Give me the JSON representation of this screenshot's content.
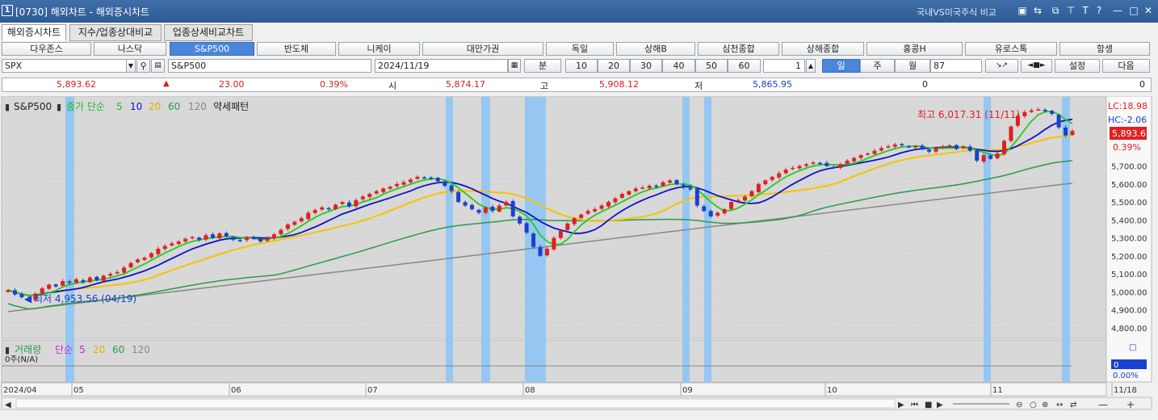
{
  "window": {
    "number": "1",
    "title": "[0730] 해외차트 - 해외증시차트",
    "right_link": "국내VS미국주식 비교",
    "icons": [
      "window-icon",
      "link-icon",
      "popup-icon",
      "pin-icon",
      "font-icon",
      "help-icon",
      "minimize-icon",
      "maximize-icon",
      "close-icon"
    ]
  },
  "tabs": [
    "해외증시차트",
    "지수/업종상대비교",
    "업종상세비교차트"
  ],
  "index_buttons": [
    "다우존스",
    "나스닥",
    "S&P500",
    "반도체",
    "니케이",
    "대만가권",
    "독일",
    "상해B",
    "심천종합",
    "상해종합",
    "홍콩H",
    "유로스톡",
    "항셍"
  ],
  "selected_index": "S&P500",
  "controls": {
    "symbol": "SPX",
    "name": "S&P500",
    "date": "2024/11/19",
    "minute_label": "분",
    "intervals": [
      "10",
      "20",
      "30",
      "40",
      "50",
      "60"
    ],
    "period_num": "1",
    "periods": [
      "일",
      "주",
      "월"
    ],
    "count": "87",
    "settings": "설정",
    "next": "다음"
  },
  "quote": {
    "price": "5,893.62",
    "change": "23.00",
    "pct": "0.39%",
    "open_label": "시",
    "open": "5,874.17",
    "high_label": "고",
    "high": "5,908.12",
    "low_label": "저",
    "low": "5,865.95",
    "vol1": "0",
    "vol2": "0"
  },
  "chart_data": {
    "type": "candlestick",
    "title": "S&P500",
    "legend": {
      "price_label": "종가 단순",
      "ma": [
        "5",
        "10",
        "20",
        "60",
        "120"
      ],
      "pattern": "약세패턴"
    },
    "volume_legend": {
      "label": "거래량",
      "simple": "단순",
      "ma": [
        "5",
        "20",
        "60",
        "120"
      ],
      "note": "0주(N/A)"
    },
    "x_labels": [
      "2024/04",
      "05",
      "06",
      "07",
      "08",
      "09",
      "10",
      "11",
      "11/18"
    ],
    "y_ticks": [
      "5,700.00",
      "5,600.00",
      "5,500.00",
      "5,400.00",
      "5,300.00",
      "5,200.00",
      "5,100.00",
      "5,000.00",
      "4,900.00",
      "4,800.00"
    ],
    "ylim": [
      4750,
      6080
    ],
    "max_label": "최고 6,017.31 (11/11)",
    "min_label": "최저 4,953.56 (04/19)",
    "lc": "LC:18.98",
    "hc": "HC:-2.06",
    "last_price": "5,893.6",
    "last_pct": "0.39%",
    "vol_value": "0",
    "vol_pct": "0.00%",
    "closes": [
      5010,
      4985,
      4970,
      4955,
      4990,
      5020,
      5040,
      5030,
      5060,
      5050,
      5070,
      5055,
      5080,
      5065,
      5090,
      5100,
      5110,
      5135,
      5160,
      5180,
      5190,
      5215,
      5240,
      5255,
      5270,
      5280,
      5295,
      5305,
      5290,
      5315,
      5300,
      5325,
      5310,
      5290,
      5285,
      5305,
      5295,
      5280,
      5300,
      5320,
      5345,
      5375,
      5390,
      5410,
      5440,
      5455,
      5470,
      5460,
      5485,
      5500,
      5475,
      5510,
      5530,
      5545,
      5560,
      5575,
      5585,
      5600,
      5610,
      5625,
      5640,
      5635,
      5630,
      5615,
      5590,
      5560,
      5500,
      5480,
      5460,
      5440,
      5470,
      5450,
      5480,
      5500,
      5420,
      5380,
      5330,
      5250,
      5200,
      5240,
      5300,
      5340,
      5380,
      5410,
      5430,
      5450,
      5460,
      5480,
      5500,
      5520,
      5545,
      5560,
      5575,
      5580,
      5590,
      5585,
      5610,
      5620,
      5600,
      5580,
      5570,
      5480,
      5450,
      5420,
      5440,
      5460,
      5500,
      5510,
      5530,
      5560,
      5600,
      5620,
      5640,
      5660,
      5680,
      5690,
      5700,
      5710,
      5720,
      5715,
      5700,
      5690,
      5710,
      5730,
      5745,
      5760,
      5770,
      5785,
      5800,
      5810,
      5820,
      5815,
      5805,
      5810,
      5795,
      5780,
      5800,
      5810,
      5815,
      5795,
      5810,
      5785,
      5730,
      5760,
      5740,
      5770,
      5840,
      5920,
      5980,
      6000,
      6010,
      6015,
      6005,
      5990,
      5915,
      5870,
      5895
    ],
    "highlight_bands": [
      [
        81,
        92
      ],
      [
        552,
        561
      ],
      [
        596,
        607
      ],
      [
        650,
        676
      ],
      [
        845,
        854
      ],
      [
        872,
        881
      ],
      [
        1218,
        1227
      ],
      [
        1315,
        1325
      ]
    ],
    "colors": {
      "up": "#e02020",
      "down": "#1a40d0",
      "ma5": "#22cc22",
      "ma10": "#1010cc",
      "ma20": "#f5c400",
      "ma60": "#2a9a4a",
      "ma120": "#888888",
      "band": "#8ec5f5"
    }
  }
}
